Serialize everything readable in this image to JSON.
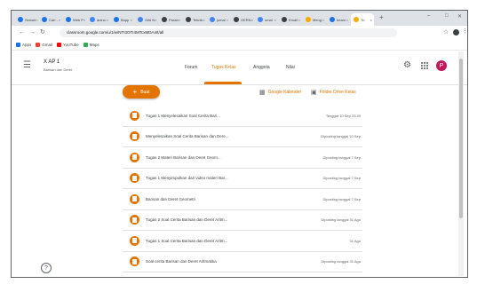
{
  "browser": {
    "tabs": [
      {
        "label": "Sensei",
        "color": "#1a73e8"
      },
      {
        "label": "Cari -",
        "color": "#1a73e8"
      },
      {
        "label": "Web P",
        "color": "#1a73e8"
      },
      {
        "label": "anino",
        "color": "#4285f4"
      },
      {
        "label": "Bupp",
        "color": "#1a73e8"
      },
      {
        "label": "Gild N",
        "color": "#4285f4"
      },
      {
        "label": "Parab",
        "color": "#3c4043"
      },
      {
        "label": "Teknik",
        "color": "#3c4043"
      },
      {
        "label": "jumal",
        "color": "#4285f4"
      },
      {
        "label": "GERN",
        "color": "#3c4043"
      },
      {
        "label": "umal",
        "color": "#4285f4"
      },
      {
        "label": "Email",
        "color": "#3c4043"
      },
      {
        "label": "Meng",
        "color": "#f9ab00"
      },
      {
        "label": "beam",
        "color": "#1a73e8"
      },
      {
        "label": "Tu",
        "color": "#f9ab00"
      }
    ],
    "url": "classroom.google.com/u/1/w/NTI3OTI4MTcxMDA4/t/all",
    "bookmarks": [
      {
        "label": "Apps",
        "color": "#1a73e8"
      },
      {
        "label": "Gmail",
        "color": "#ea4335"
      },
      {
        "label": "YouTube",
        "color": "#ff0000"
      },
      {
        "label": "Maps",
        "color": "#34a853"
      }
    ]
  },
  "classroom": {
    "class_name": "X AP 1",
    "class_subtitle": "Barisan dan Deret",
    "nav": [
      "Forum",
      "Tugas Kelas",
      "Anggota",
      "Nilai"
    ],
    "avatar_letter": "P",
    "create_label": "Buat",
    "calendar_link": "Google Kalender",
    "drive_link": "Folder Drive Kelas",
    "accent": "#e37400",
    "assignments": [
      {
        "title": "Tugas 1 Menyelesaikan Soal Cerita Bari...",
        "date": "Tenggat 10 Sep 23.59"
      },
      {
        "title": "Menyelesaikan Soal Cerita Barisan dan Dere...",
        "date": "Diposting tanggal 10 Sep"
      },
      {
        "title": "Tugas 2 Materi Barisan dan Deret Geom...",
        "date": "Diposting tanggal 7 Sep"
      },
      {
        "title": "Tugas 1 Menyimpulkan dari video materi Bar...",
        "date": "Diposting tanggal 7 Sep"
      },
      {
        "title": "Barisan dan Deret Geometri",
        "date": "Diposting tanggal 7 Sep"
      },
      {
        "title": "Tugas 2 Soal Cerita Barisan dan Deret Aritm...",
        "date": "Diposting tanggal 31 Agu"
      },
      {
        "title": "Tugas 1 Soal Cerita Barisan dan Deret Aritm...",
        "date": "31 Agu"
      },
      {
        "title": "Soal cerita Barisan dan Deret Aritmatika",
        "date": "Diposting tanggal 31 Agu"
      }
    ]
  }
}
